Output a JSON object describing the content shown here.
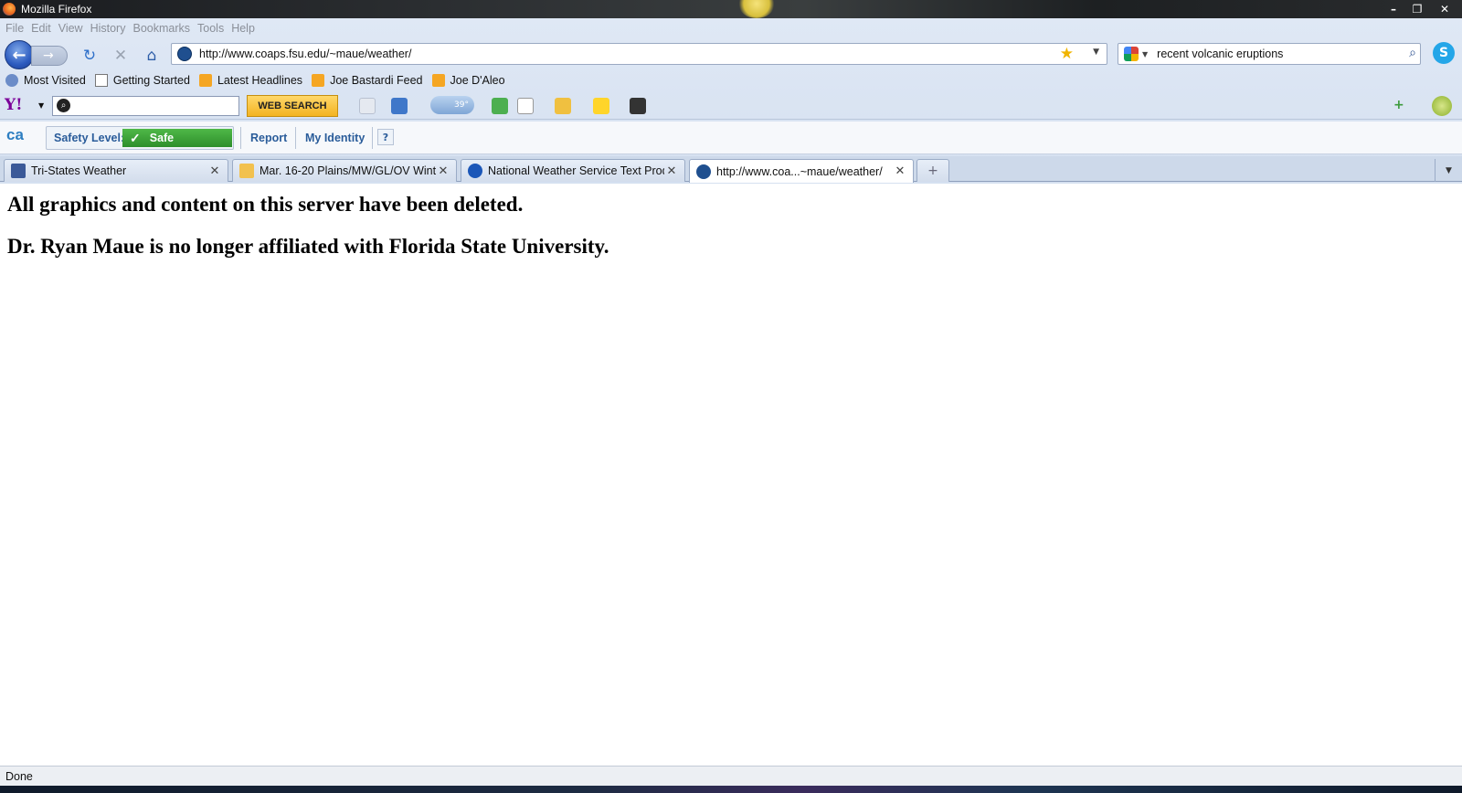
{
  "window": {
    "title": "Mozilla Firefox"
  },
  "menu": [
    "File",
    "Edit",
    "View",
    "History",
    "Bookmarks",
    "Tools",
    "Help"
  ],
  "navigation": {
    "url": "http://www.coaps.fsu.edu/~maue/weather/",
    "search_query": "recent volcanic eruptions"
  },
  "bookmarks": [
    {
      "label": "Most Visited",
      "icon": "globe-icon"
    },
    {
      "label": "Getting Started",
      "icon": "page-icon"
    },
    {
      "label": "Latest Headlines",
      "icon": "rss-icon"
    },
    {
      "label": "Joe Bastardi Feed",
      "icon": "rss-icon"
    },
    {
      "label": "Joe D'Aleo",
      "icon": "rss-icon"
    }
  ],
  "yahoo_toolbar": {
    "search_button": "WEB SEARCH",
    "weather_temp": "39°"
  },
  "ca_toolbar": {
    "safety_label": "Safety Level:",
    "safety_value": "Safe",
    "report": "Report",
    "identity": "My Identity",
    "help": "?"
  },
  "tabs": [
    {
      "label": "Tri-States Weather",
      "active": false
    },
    {
      "label": "Mar. 16-20 Plains/MW/GL/OV Wint...",
      "active": false
    },
    {
      "label": "National Weather Service Text Prod...",
      "active": false
    },
    {
      "label": "http://www.coa...~maue/weather/",
      "active": true
    }
  ],
  "content": {
    "line1": "All graphics and content on this server have been deleted.",
    "line2": "Dr. Ryan Maue is no longer affiliated with Florida State University."
  },
  "status": "Done",
  "colors": {
    "safe_green": "#2e8f2b",
    "link_blue": "#2a5c9a",
    "chrome_blue": "#d5e0f0"
  }
}
